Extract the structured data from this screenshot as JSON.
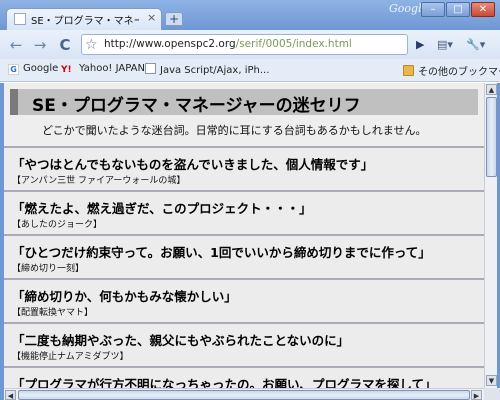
{
  "window": {
    "brand": "Google",
    "minimize_glyph": "–",
    "maximize_glyph": "□",
    "close_glyph": "✕"
  },
  "tab": {
    "title": "SE・プログラマ・マネージャーの...",
    "close_glyph": "×",
    "new_tab_glyph": "+"
  },
  "toolbar": {
    "back_glyph": "←",
    "forward_glyph": "→",
    "reload_glyph": "C",
    "star_glyph": "☆",
    "url_host": "http://www.openspc2.org",
    "url_rest": "/serif/0005/index.html",
    "go_glyph": "▶",
    "page_menu_glyph": "▤▾",
    "wrench_glyph": "🔧▾"
  },
  "bookmarks": {
    "items": [
      {
        "label": "Google",
        "icon": "google-favicon"
      },
      {
        "label": "Yahoo! JAPAN",
        "icon": "yahoo-favicon"
      },
      {
        "label": "Java Script/Ajax, iPh...",
        "icon": "page-icon"
      }
    ],
    "other_label": "その他のブックマーク"
  },
  "page": {
    "title": "SE・プログラマ・マネージャーの迷セリフ",
    "subtitle": "どこかで聞いたような迷台詞。日常的に耳にする台詞もあるかもしれません。",
    "entries": [
      {
        "quote": "「やつはとんでもないものを盗んでいきました、個人情報です」",
        "source": "【アンパン三世 ファイアーウォールの城】"
      },
      {
        "quote": "「燃えたよ、燃え過ぎだ、このプロジェクト・・・」",
        "source": "【あしたのジョーク】"
      },
      {
        "quote": "「ひとつだけ約束守って。お願い、1回でいいから締め切りまでに作って」",
        "source": "【締め切り一刻】"
      },
      {
        "quote": "「締め切りか、何もかもみな懐かしい」",
        "source": "【配置転換ヤマト】"
      },
      {
        "quote": "「二度も納期やぶった、親父にもやぶられたことないのに」",
        "source": "【機能停止ナムアミダブツ】"
      },
      {
        "quote": "「プログラマが行方不明になっちゃったの。お願い、プログラマを探して」",
        "source": ""
      }
    ]
  },
  "scrollbar": {
    "up_glyph": "▲",
    "down_glyph": "▼",
    "left_glyph": "◀",
    "right_glyph": "▶"
  }
}
